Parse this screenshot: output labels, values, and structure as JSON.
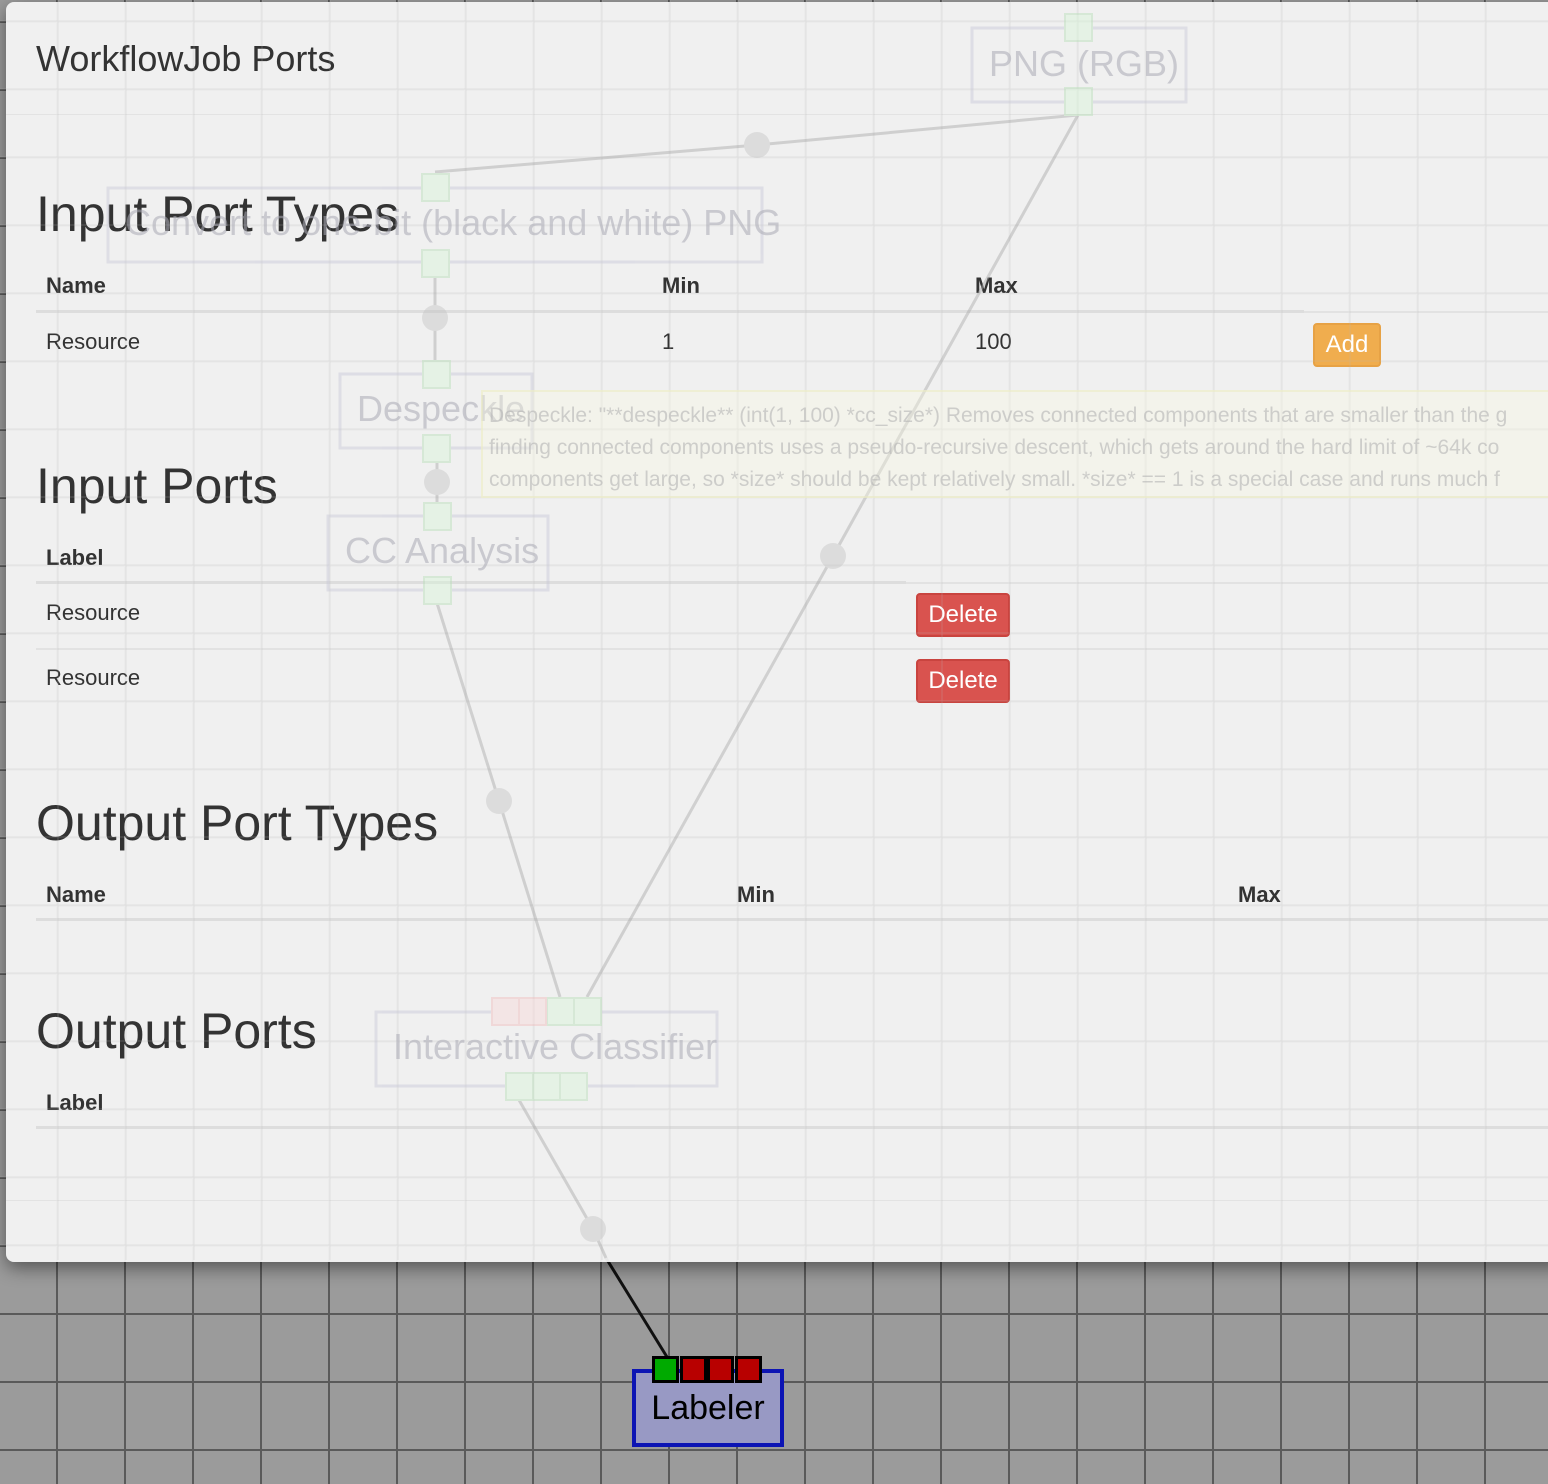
{
  "modal": {
    "title": "WorkflowJob Ports",
    "input_port_types": {
      "heading": "Input Port Types",
      "columns": [
        "Name",
        "Min",
        "Max"
      ],
      "rows": [
        {
          "name": "Resource",
          "min": "1",
          "max": "100",
          "action": "Add"
        }
      ]
    },
    "input_ports": {
      "heading": "Input Ports",
      "columns": [
        "Label"
      ],
      "rows": [
        {
          "label": "Resource",
          "action": "Delete"
        },
        {
          "label": "Resource",
          "action": "Delete"
        }
      ]
    },
    "output_port_types": {
      "heading": "Output Port Types",
      "columns": [
        "Name",
        "Min",
        "Max"
      ],
      "rows": []
    },
    "output_ports": {
      "heading": "Output Ports",
      "columns": [
        "Label"
      ],
      "rows": []
    }
  },
  "workflow_nodes": {
    "png_rgb": "PNG (RGB)",
    "convert_bw": "Convert to one-bit (black and white) PNG",
    "despeckle": "Despeckle",
    "cc_analysis": "CC Analysis",
    "interactive_classifier": "Interactive Classifier",
    "labeler": "Labeler"
  },
  "tooltip": {
    "lines": [
      "Despeckle: \"**despeckle** (int(1, 100) *cc_size*) Removes connected components that are smaller than the g",
      "finding connected components uses a pseudo-recursive descent, which gets around the hard limit of ~64k co",
      "components get large, so *size* should be kept relatively small. *size* == 1 is a special case and runs much f"
    ]
  },
  "colors": {
    "port_connected": "#00aa00",
    "port_unconnected": "#b80000",
    "node_fill": "#9899c4",
    "node_border": "#0c14b4",
    "add_button": "#f0ad4e",
    "delete_button": "#d9534f"
  }
}
